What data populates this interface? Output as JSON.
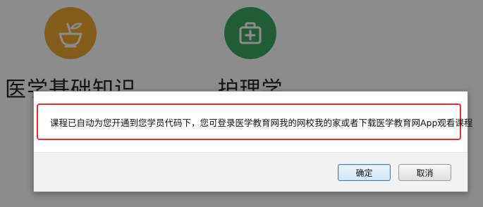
{
  "categories": [
    {
      "label": "医学基础知识",
      "icon": "mortar-pestle-icon",
      "color": "#f0a830"
    },
    {
      "label": "护理学",
      "icon": "medical-kit-icon",
      "color": "#3aab62"
    }
  ],
  "dialog": {
    "message": "课程已自动为您开通到您学员代码下，您可登录医学教育网我的网校我的家或者下载医学教育网App观看课程",
    "ok_label": "确定",
    "cancel_label": "取消",
    "highlight_color": "#e53030"
  }
}
